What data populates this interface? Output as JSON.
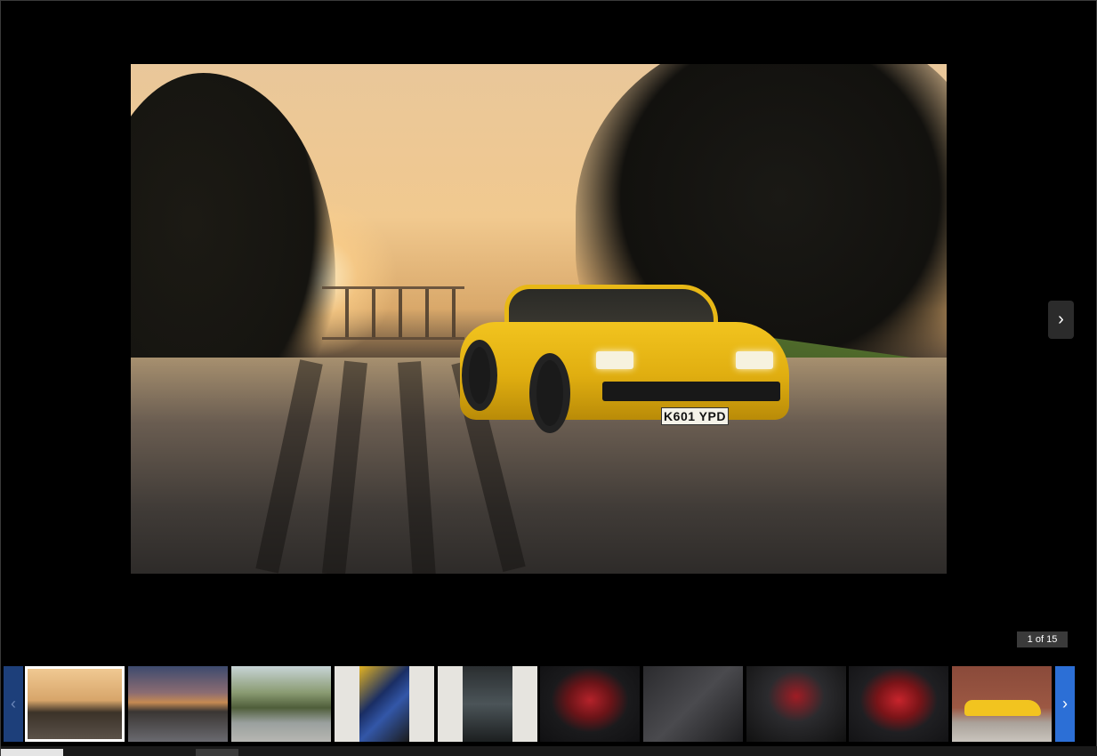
{
  "main_photo": {
    "alt": "Yellow Ferrari Mondial at sunset",
    "plate_text": "K601 YPD"
  },
  "navigation": {
    "next_icon": "chevron-right-icon",
    "prev_icon": "chevron-left-icon",
    "next_glyph": "›",
    "prev_glyph": "‹"
  },
  "counter": {
    "text": "1 of 15"
  },
  "thumbnails": [
    {
      "label": "thumbnail-1-sunset"
    },
    {
      "label": "thumbnail-2-dusk"
    },
    {
      "label": "thumbnail-3-garden"
    },
    {
      "label": "thumbnail-4-engine"
    },
    {
      "label": "thumbnail-5-interior"
    },
    {
      "label": "thumbnail-6-dashboard"
    },
    {
      "label": "thumbnail-7-console"
    },
    {
      "label": "thumbnail-8-steering"
    },
    {
      "label": "thumbnail-9-plaque"
    },
    {
      "label": "thumbnail-10-side"
    }
  ],
  "colors": {
    "background": "#000000",
    "thumb_next_accent": "#2c6fd6",
    "car_yellow": "#f2c41f"
  }
}
